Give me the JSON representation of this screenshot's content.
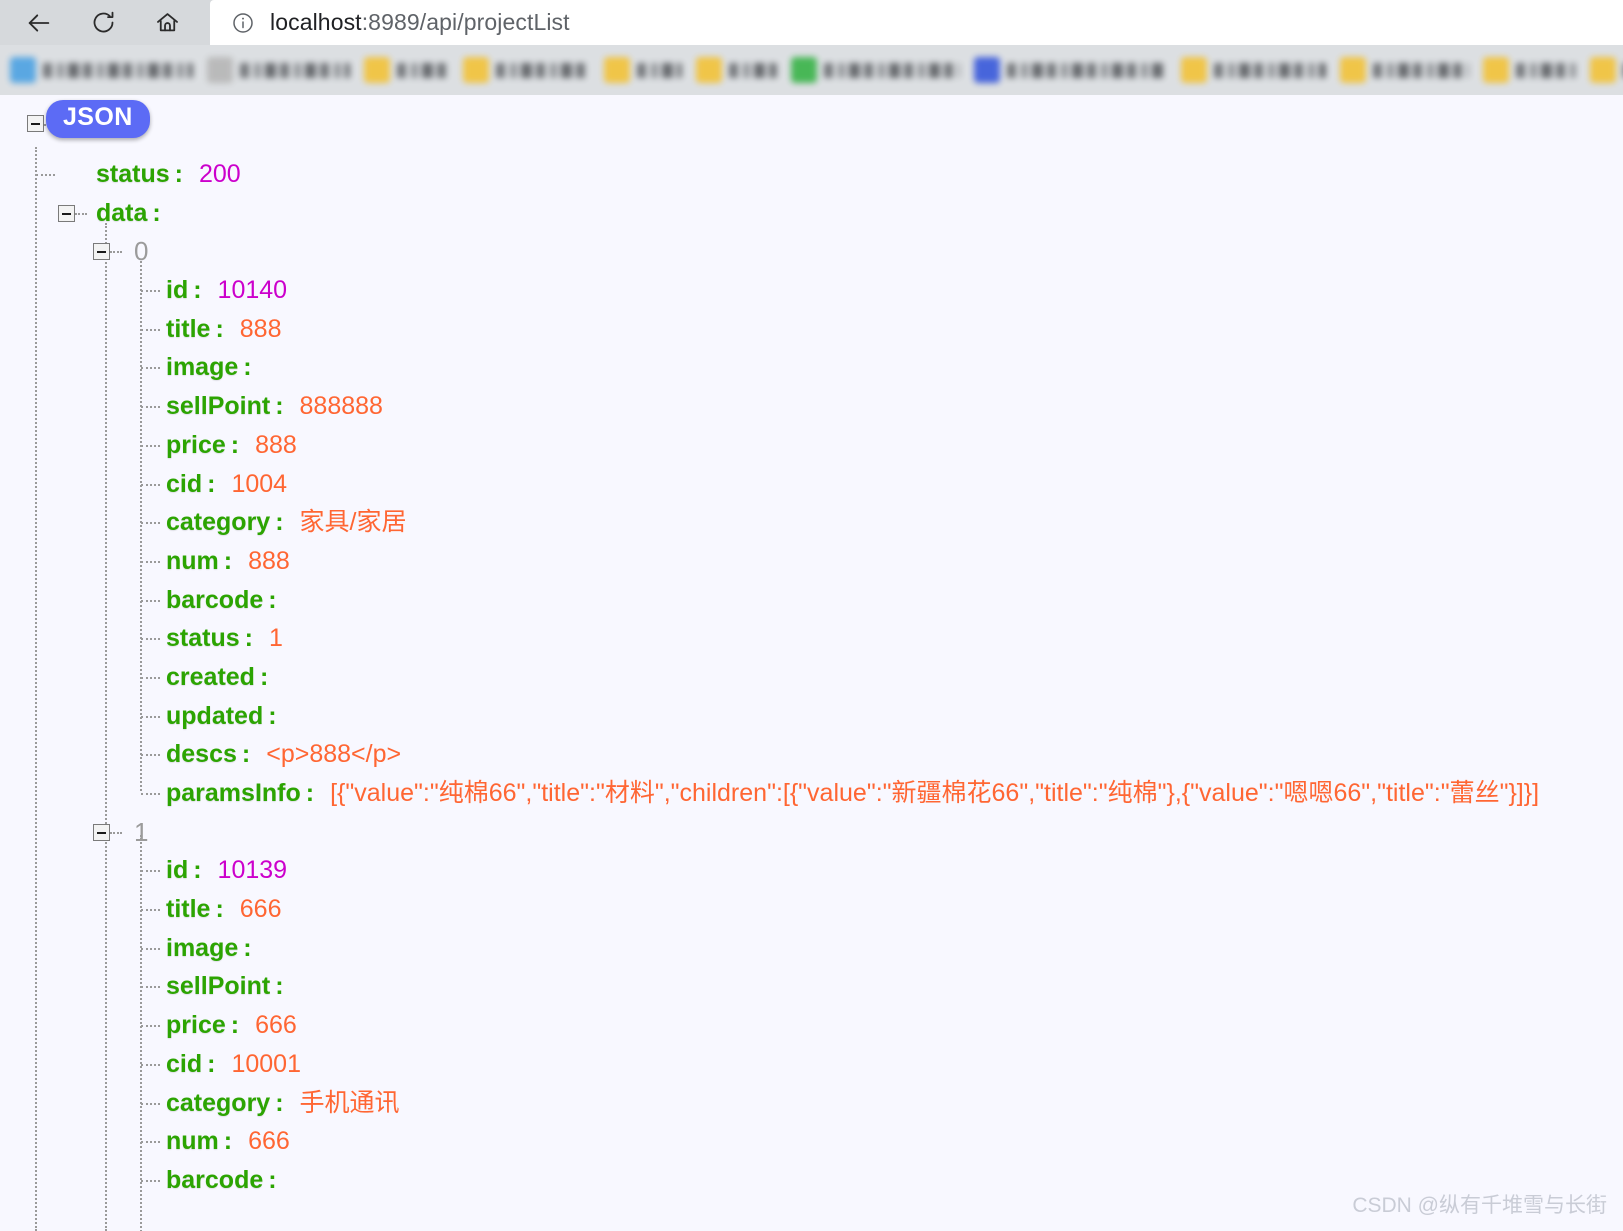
{
  "browser": {
    "nav": {
      "back_label": "Back",
      "reload_label": "Reload",
      "home_label": "Home"
    },
    "omnibox": {
      "info_icon": "info-circle-icon",
      "url_host": "localhost",
      "url_rest": ":8989/api/projectList",
      "url_full": "localhost:8989/api/projectList"
    },
    "bookmarks": [
      {
        "icon_color": "#4fa3e3"
      },
      {
        "icon_color": "#b5b5b5"
      },
      {
        "icon_color": "#f2c33c"
      },
      {
        "icon_color": "#f2c33c"
      },
      {
        "icon_color": "#f2c33c"
      },
      {
        "icon_color": "#f2c33c"
      },
      {
        "icon_color": "#3cb44b"
      },
      {
        "icon_color": "#3b5bdb"
      },
      {
        "icon_color": "#f2c33c"
      },
      {
        "icon_color": "#f2c33c"
      },
      {
        "icon_color": "#f2c33c"
      },
      {
        "icon_color": "#f2c33c"
      }
    ]
  },
  "viewer": {
    "root_badge": "JSON",
    "watermark": "CSDN @纵有千堆雪与长街",
    "colors": {
      "key": "#2ca402",
      "number": "#cc00cc",
      "string": "#ff6633",
      "index": "#9b9b9b",
      "badge_bg": "#5c6bf5",
      "background": "#f8f8ff"
    }
  },
  "json": {
    "status_key": "status",
    "status_value": "200",
    "data_key": "data",
    "items": [
      {
        "index": "0",
        "fields": [
          {
            "key": "id",
            "value": "10140",
            "type": "num"
          },
          {
            "key": "title",
            "value": "888",
            "type": "str"
          },
          {
            "key": "image",
            "value": "",
            "type": "str"
          },
          {
            "key": "sellPoint",
            "value": "888888",
            "type": "str"
          },
          {
            "key": "price",
            "value": "888",
            "type": "str"
          },
          {
            "key": "cid",
            "value": "1004",
            "type": "str"
          },
          {
            "key": "category",
            "value": "家具/家居",
            "type": "str"
          },
          {
            "key": "num",
            "value": "888",
            "type": "str"
          },
          {
            "key": "barcode",
            "value": "",
            "type": "str"
          },
          {
            "key": "status",
            "value": "1",
            "type": "str"
          },
          {
            "key": "created",
            "value": "",
            "type": "str"
          },
          {
            "key": "updated",
            "value": "",
            "type": "str"
          },
          {
            "key": "descs",
            "value": "<p>888</p>",
            "type": "str"
          },
          {
            "key": "paramsInfo",
            "value": "[{\"value\":\"纯棉66\",\"title\":\"材料\",\"children\":[{\"value\":\"新疆棉花66\",\"title\":\"纯棉\"},{\"value\":\"嗯嗯66\",\"title\":\"蕾丝\"}]}]",
            "type": "str"
          }
        ]
      },
      {
        "index": "1",
        "fields": [
          {
            "key": "id",
            "value": "10139",
            "type": "num"
          },
          {
            "key": "title",
            "value": "666",
            "type": "str"
          },
          {
            "key": "image",
            "value": "",
            "type": "str"
          },
          {
            "key": "sellPoint",
            "value": "",
            "type": "str"
          },
          {
            "key": "price",
            "value": "666",
            "type": "str"
          },
          {
            "key": "cid",
            "value": "10001",
            "type": "str"
          },
          {
            "key": "category",
            "value": "手机通讯",
            "type": "str"
          },
          {
            "key": "num",
            "value": "666",
            "type": "str"
          },
          {
            "key": "barcode",
            "value": "",
            "type": "str"
          }
        ]
      }
    ]
  }
}
